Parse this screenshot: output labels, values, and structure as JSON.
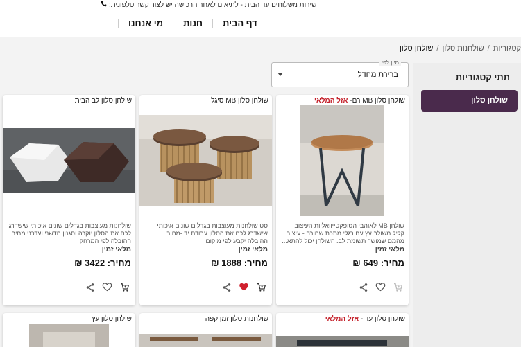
{
  "topbar": {
    "message": "שירות משלוחים עד הבית - לתיאום לאחר הרכישה יש לצור קשר טלפונית:"
  },
  "nav": {
    "items": [
      "דף הבית",
      "חנות",
      "מי אנחנו"
    ]
  },
  "breadcrumb": {
    "items": [
      "קטגוריות",
      "שולחנות סלון",
      "שולחן סלון"
    ]
  },
  "sort": {
    "label": "מיין לפי",
    "value": "ברירת מחדל"
  },
  "sidebar": {
    "title": "תתי קטגוריות",
    "categories": [
      "שולחן סלון"
    ]
  },
  "products": [
    {
      "title": "שולחן סלון MB רם-",
      "sale_badge": "אזל המלאי",
      "description": "שולחן MB לאוהבי הסופקטייוואליות העיצוב קליל משולב עץ עם רגלי מתכת שחורה - עיצוב מהמם שמושך תשומת לב. השולחן יכול להתא...",
      "stock": "מלאי זמין",
      "price": "מחיר: 649 ₪",
      "favorited": false
    },
    {
      "title": "שולחן סלון MB סיגל",
      "sale_badge": "",
      "description": "סט שולחנות מעוצבות בגדלים שונים איכותי שישדרג לכם את הסלון עבודת יד -מחיר ההובלה יקבע לפי מיקום",
      "stock": "מלאי זמין",
      "price": "מחיר: 1888 ₪",
      "favorited": true
    },
    {
      "title": "שולחן סלון לב הבית",
      "sale_badge": "",
      "description": "שולחנות מעוצבות בגדלים שונים איכותי שישדרג לכם את הסלון יוקרה וסגנון חדשני ועדכני מחיר ההובלה לפי המרחק",
      "stock": "מלאי זמין",
      "price": "מחיר: 3422 ₪",
      "favorited": false
    },
    {
      "title": "שולחן סלון עדן-",
      "sale_badge": "אזל המלאי"
    },
    {
      "title": "שולחנות סלון זמן קפה",
      "sale_badge": ""
    },
    {
      "title": "שולחן סלון עץ",
      "sale_badge": ""
    }
  ],
  "colors": {
    "accent": "#4a2a4c",
    "sale": "#c4202a",
    "favorite": "#d0202e"
  }
}
